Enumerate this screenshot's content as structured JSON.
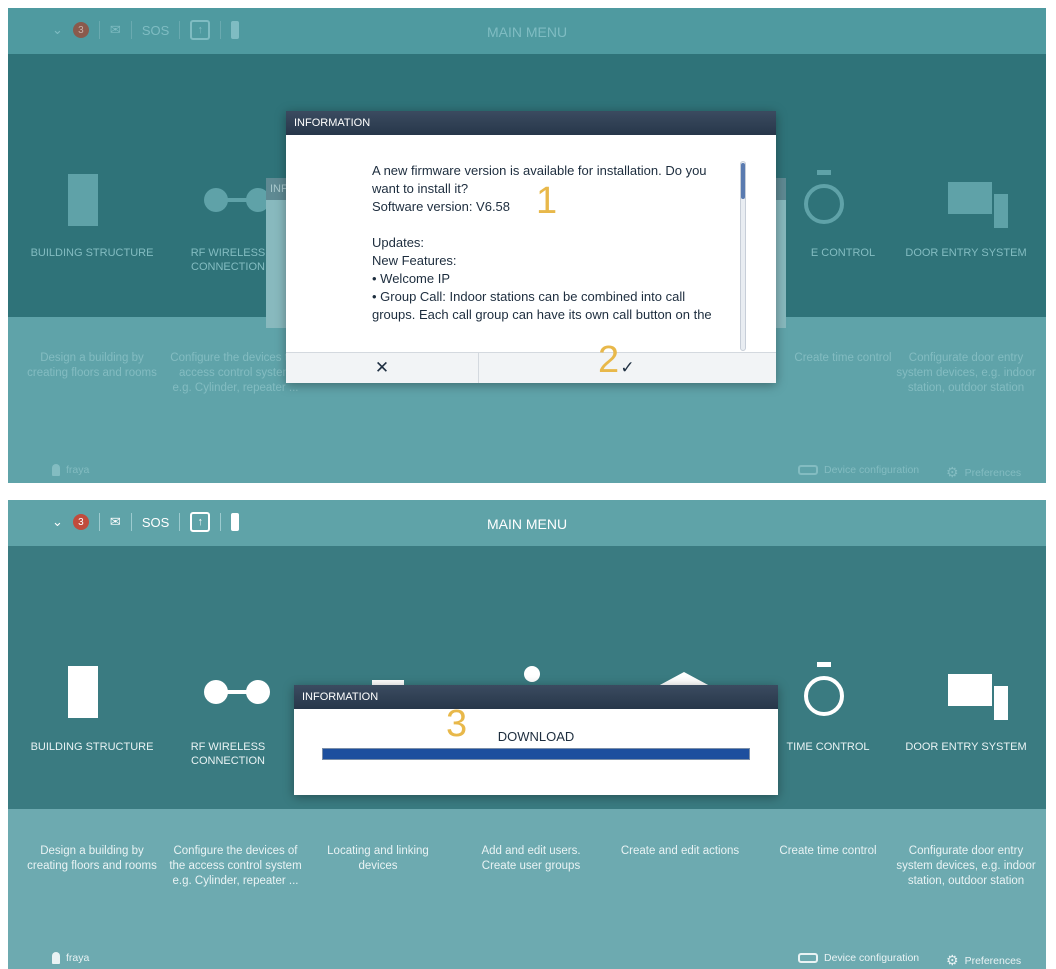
{
  "topbar": {
    "title": "MAIN MENU",
    "badge_count": "3",
    "sos_label": "SOS"
  },
  "tiles": [
    {
      "label": "BUILDING STRUCTURE",
      "desc": "Design a building by creating floors and rooms",
      "icon": "building-icon"
    },
    {
      "label": "RF WIRELESS CONNECTION",
      "desc": "Configure the devices of the access control system e.g. Cylinder, repeater ...",
      "icon": "rf-connection-icon"
    },
    {
      "label": "",
      "desc": "Locating and linking devices",
      "icon": "pin-icon"
    },
    {
      "label": "",
      "desc": "Add and edit users. Create user groups",
      "icon": "user-icon"
    },
    {
      "label": "",
      "desc": "Create and edit actions",
      "icon": "roof-icon"
    },
    {
      "label": "TIME CONTROL",
      "desc": "Create time control",
      "icon": "stopwatch-icon"
    },
    {
      "label": "DOOR ENTRY SYSTEM",
      "desc": "Configurate door entry system devices, e.g. indoor station, outdoor station",
      "icon": "door-entry-icon"
    }
  ],
  "shot1_tiles": {
    "building_label": "BUILDING STRUCTURE",
    "rf_label_1": "RF WIRELESS",
    "rf_label_2": "CONNECTION",
    "time_label_partial": "E CONTROL",
    "door_label": "DOOR ENTRY SYSTEM",
    "building_desc": "Design a building by creating floors and rooms",
    "rf_desc_partial": "Configure the devices the access control system e.g. Cylinder, repeater ...",
    "time_desc": "Create time control",
    "door_desc": "Configurate door entry system devices, e.g. indoor station, outdoor station",
    "behind_dialog_title_partial": "INF"
  },
  "footer": {
    "user": "fraya",
    "device_config": "Device configuration",
    "preferences": "Preferences"
  },
  "info_dialog": {
    "title": "INFORMATION",
    "line1": "A new firmware version is available for installation. Do you",
    "line2": "want to install it?",
    "line3": "Software version: V6.58",
    "line5": "Updates:",
    "line6": "New Features:",
    "line7": "• Welcome IP",
    "line8": "• Group Call: Indoor stations can be combined into call",
    "line9": "groups. Each call group can have its own call button on the",
    "cancel_symbol": "✕",
    "confirm_symbol": "✓"
  },
  "download_dialog": {
    "title": "INFORMATION",
    "status": "DOWNLOAD",
    "progress": 1.0,
    "progress_color": "#1d4f9e"
  },
  "markers": {
    "m1": "1",
    "m2": "2",
    "m3": "3"
  },
  "colors": {
    "marker": "#e8b84a",
    "badge": "#c14b3c",
    "dialog_header": "#2f3f53"
  }
}
